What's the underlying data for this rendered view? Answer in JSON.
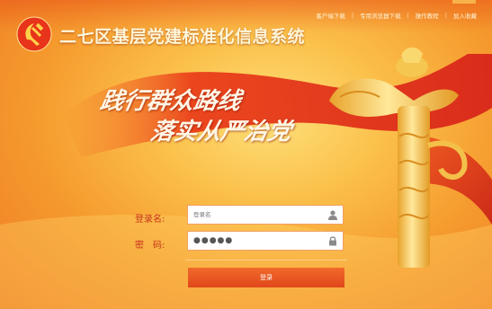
{
  "header": {
    "title": "二七区基层党建标准化信息系统",
    "links": [
      "客户端下载",
      "专用浏览器下载",
      "操作教程",
      "加入收藏"
    ]
  },
  "slogan": {
    "line1": "践行群众路线",
    "line2": "落实从严治党"
  },
  "login": {
    "username_label": "登录名:",
    "username_placeholder": "登录名",
    "password_label": "密　码:",
    "password_value": "●●●●●",
    "submit_label": "登录"
  },
  "colors": {
    "accent": "#e0461a",
    "label": "#c8321a",
    "ribbon": "#e8341a"
  },
  "icons": {
    "logo": "party-emblem-icon",
    "user": "user-icon",
    "lock": "lock-icon"
  }
}
